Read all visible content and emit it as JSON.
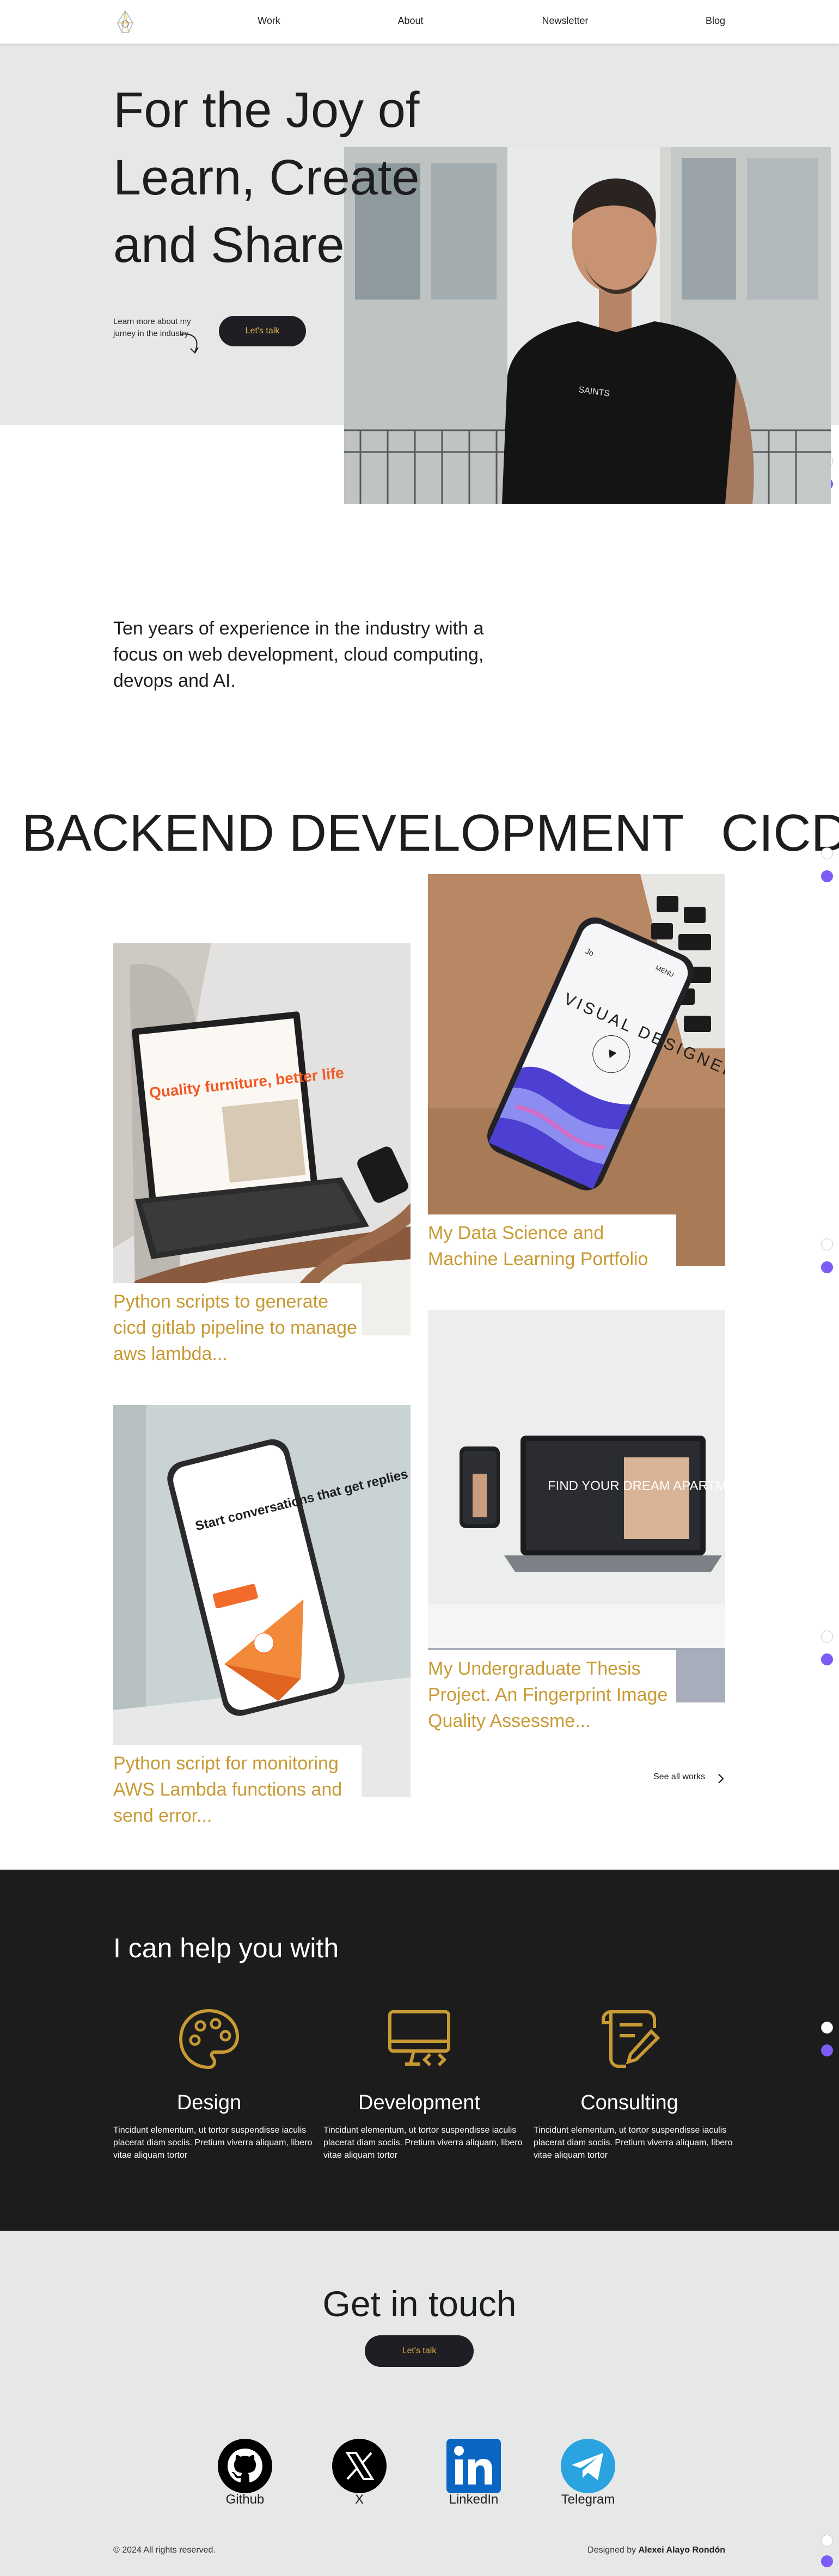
{
  "nav": {
    "items": [
      {
        "label": "Work"
      },
      {
        "label": "About"
      },
      {
        "label": "Newsletter"
      },
      {
        "label": "Blog"
      }
    ]
  },
  "hero": {
    "title_line1": "For the Joy of",
    "title_line2": "Learn, Create",
    "title_line3": "and Share",
    "side_text": "Learn more about my jurney in the industry",
    "cta_label": "Let's talk",
    "shirt_text": "SAINTS"
  },
  "intro": {
    "text": "Ten years of experience in the industry with a focus on web development, cloud computing, devops and AI."
  },
  "marquee": {
    "items": [
      "BACKEND DEVELOPMENT",
      "CICD",
      "D"
    ]
  },
  "projects": {
    "cards": [
      {
        "title": "Python scripts to generate cicd gitlab pipeline to manage aws lambda...",
        "mockup_headline": "Quality furniture, better life"
      },
      {
        "title": "My Data Science and Machine Learning Portfolio",
        "mockup_headline": "VISUAL DESIGNER",
        "mockup_menu": "MENU"
      },
      {
        "title": "Python script for monitoring AWS Lambda functions and send error...",
        "mockup_headline": "Start conversations that get replies"
      },
      {
        "title": "My Undergraduate Thesis Project. An Fingerprint Image Quality Assessme...",
        "mockup_headline": "FIND YOUR DREAM APARTMENT"
      }
    ],
    "see_all_label": "See all works"
  },
  "services": {
    "title": "I can help you with",
    "items": [
      {
        "title": "Design",
        "desc": "Tincidunt elementum, ut tortor suspendisse iaculis placerat diam sociis. Pretium viverra aliquam, libero vitae aliquam tortor",
        "icon": "palette-icon"
      },
      {
        "title": "Development",
        "desc": "Tincidunt elementum, ut tortor suspendisse iaculis placerat diam sociis. Pretium viverra aliquam, libero vitae aliquam tortor",
        "icon": "monitor-code-icon"
      },
      {
        "title": "Consulting",
        "desc": "Tincidunt elementum, ut tortor suspendisse iaculis placerat diam sociis. Pretium viverra aliquam, libero vitae aliquam tortor",
        "icon": "document-edit-icon"
      }
    ]
  },
  "contact": {
    "title": "Get in touch",
    "cta_label": "Let's talk",
    "socials": [
      {
        "label": "Github",
        "icon": "github-icon",
        "color": "#000000"
      },
      {
        "label": "X",
        "icon": "x-icon",
        "color": "#000000"
      },
      {
        "label": "LinkedIn",
        "icon": "linkedin-icon",
        "color": "#0a66c2"
      },
      {
        "label": "Telegram",
        "icon": "telegram-icon",
        "color": "#2aa3e0"
      }
    ]
  },
  "footer": {
    "copyright": "© 2024 All rights reserved.",
    "designed_prefix": "Designed by",
    "designer": "Alexei Alayo Rondón"
  },
  "colors": {
    "accent_gold": "#c89a34",
    "dark": "#1e1e24",
    "hero_bg": "#e5e8e6",
    "services_bg": "#1c1c1c"
  }
}
